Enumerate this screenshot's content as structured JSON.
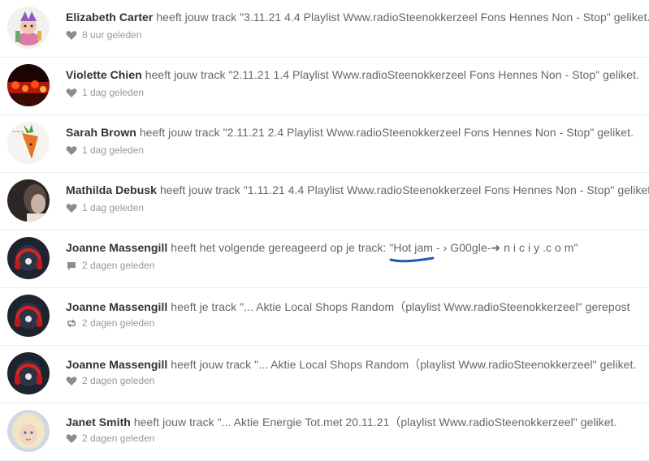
{
  "notifications": [
    {
      "user": "Elizabeth Carter",
      "action": " heeft jouw track \"3.11.21 4.4 Playlist Www.radioSteenokkerzeel Fons Hennes Non - Stop\" geliket.",
      "time": "8 uur geleden",
      "icon": "heart-icon",
      "avatar": "cartoon-character-avatar"
    },
    {
      "user": "Violette Chien",
      "action": " heeft jouw track \"2.11.21 1.4 Playlist Www.radioSteenokkerzeel Fons Hennes Non - Stop\" geliket.",
      "time": "1 dag geleden",
      "icon": "heart-icon",
      "avatar": "red-lights-avatar"
    },
    {
      "user": "Sarah Brown",
      "action": " heeft jouw track \"2.11.21 2.4 Playlist Www.radioSteenokkerzeel Fons Hennes Non - Stop\" geliket.",
      "time": "1 dag geleden",
      "icon": "heart-icon",
      "avatar": "carrot-avatar"
    },
    {
      "user": "Mathilda Debusk",
      "action": " heeft jouw track \"1.11.21 4.4 Playlist Www.radioSteenokkerzeel Fons Hennes Non - Stop\" geliket.",
      "time": "1 dag geleden",
      "icon": "heart-icon",
      "avatar": "portrait-avatar"
    },
    {
      "user": "Joanne Massengill",
      "action": " heeft het volgende gereageerd op je track: ",
      "comment_highlight": "\"Hot jam",
      "comment_rest": " - › G00gle-➜ n i c i y .c o m\"",
      "time": "2 dagen geleden",
      "icon": "comment-icon",
      "avatar": "headphones-avatar"
    },
    {
      "user": "Joanne Massengill",
      "action": " heeft je track \"... Aktie Local Shops Random（playlist Www.radioSteenokkerzeel\" gerepost",
      "time": "2 dagen geleden",
      "icon": "repost-icon",
      "avatar": "headphones-avatar"
    },
    {
      "user": "Joanne Massengill",
      "action": " heeft jouw track \"... Aktie Local Shops Random（playlist Www.radioSteenokkerzeel\" geliket.",
      "time": "2 dagen geleden",
      "icon": "heart-icon",
      "avatar": "headphones-avatar"
    },
    {
      "user": "Janet Smith",
      "action": " heeft jouw track \"... Aktie Energie Tot.met 20.11.21（playlist Www.radioSteenokkerzeel\" geliket.",
      "time": "2 dagen geleden",
      "icon": "heart-icon",
      "avatar": "blonde-portrait-avatar"
    }
  ],
  "colors": {
    "username": "#333333",
    "text": "#666666",
    "meta": "#999999",
    "underline": "#1a5fb4"
  }
}
